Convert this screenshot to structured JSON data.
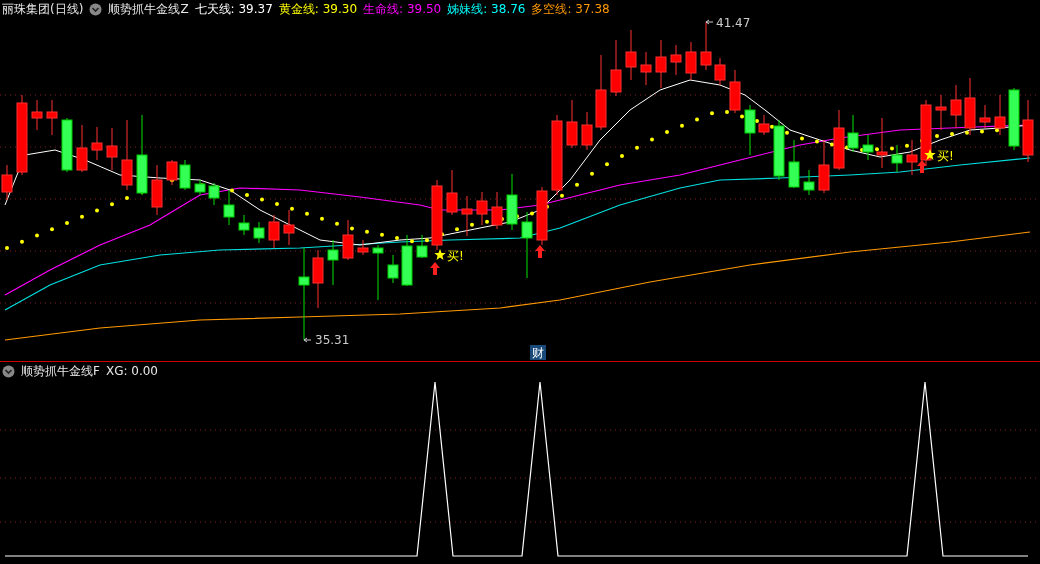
{
  "header": {
    "title": "丽珠集团(日线)",
    "indicator": "顺势抓牛金线Z",
    "legend": [
      {
        "label": "七天线:",
        "value": "39.37",
        "color": "#ffffff"
      },
      {
        "label": "黄金线:",
        "value": "39.30",
        "color": "#ffff00"
      },
      {
        "label": "生命线:",
        "value": "39.50",
        "color": "#ff00ff"
      },
      {
        "label": "姊妹线:",
        "value": "38.76",
        "color": "#00ffff"
      },
      {
        "label": "多空线:",
        "value": "37.38",
        "color": "#ff9900"
      }
    ]
  },
  "main_chart": {
    "high_label": "41.47",
    "low_label": "35.31",
    "buy_labels": [
      "买!",
      "买!"
    ],
    "badge": "财"
  },
  "lower_panel": {
    "indicator": "顺势抓牛金线F",
    "label": "XG:",
    "value": "0.00"
  }
}
